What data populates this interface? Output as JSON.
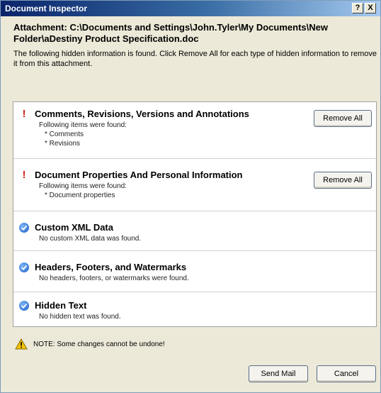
{
  "window": {
    "title": "Document Inspector",
    "help_label": "?",
    "close_label": "X"
  },
  "attachment": {
    "line1": "Attachment: C:\\Documents and Settings\\John.Tyler\\My Documents\\New",
    "line2": "Folder\\aDestiny Product Specification.doc"
  },
  "description": "The following hidden information is found. Click Remove All for each type of hidden information to remove it from this attachment.",
  "items": [
    {
      "status_icon": "warning-icon",
      "title": "Comments, Revisions, Versions and Annotations",
      "text": "Following items were found:",
      "subitems": [
        "* Comments",
        "* Revisions"
      ],
      "button_label": "Remove All"
    },
    {
      "status_icon": "warning-icon",
      "title": "Document Properties And Personal Information",
      "text": "Following items were found:",
      "subitems": [
        "* Document properties"
      ],
      "button_label": "Remove All"
    },
    {
      "status_icon": "check-icon",
      "title": "Custom XML Data",
      "text": "No custom XML data was found."
    },
    {
      "status_icon": "check-icon",
      "title": "Headers, Footers, and Watermarks",
      "text": "No headers, footers, or watermarks were found."
    },
    {
      "status_icon": "check-icon",
      "title": "Hidden Text",
      "text": "No hidden text was found."
    }
  ],
  "note": {
    "icon": "warning-triangle-icon",
    "text": "NOTE: Some changes cannot be undone!"
  },
  "footer": {
    "send_label": "Send Mail",
    "cancel_label": "Cancel"
  },
  "colors": {
    "titlebar": "#0a246a",
    "warning": "#d0201b",
    "check": "#1c5fc7"
  }
}
